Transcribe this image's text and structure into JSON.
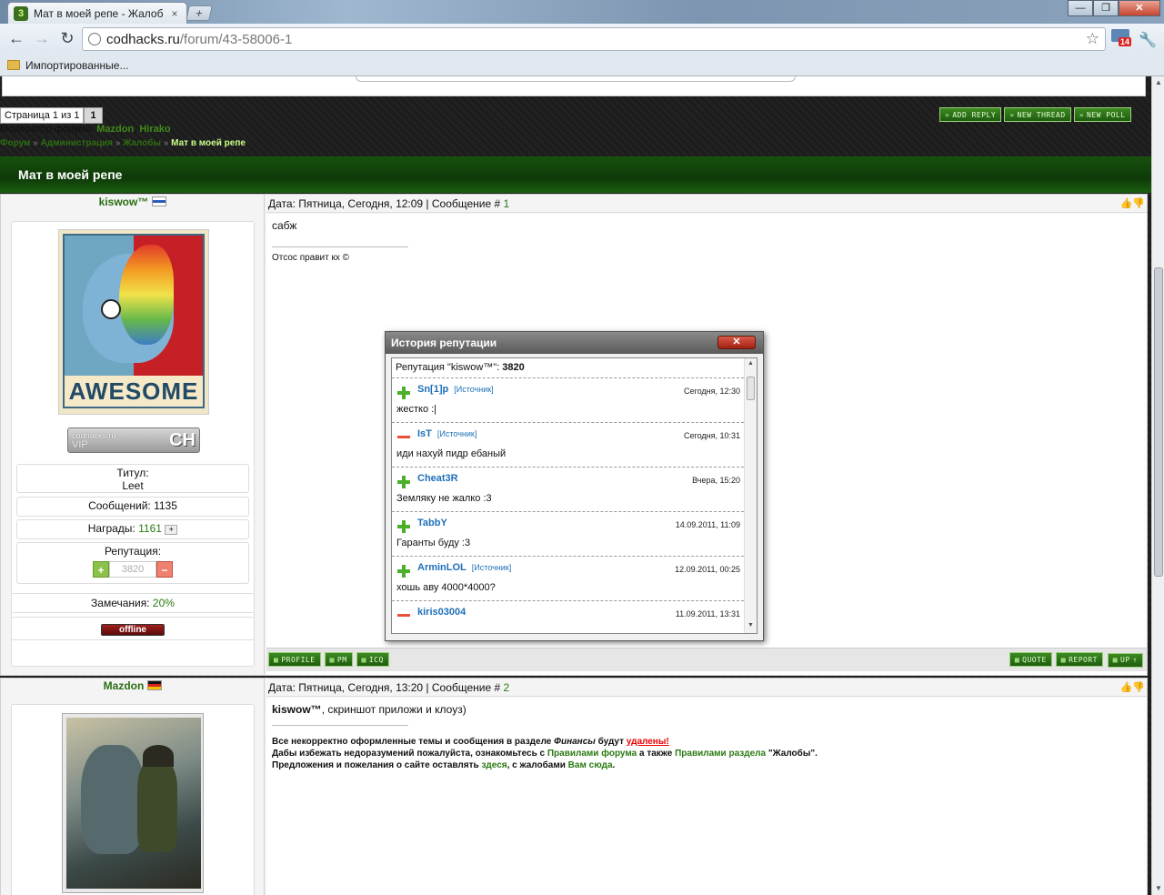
{
  "browser": {
    "tab_title": "Мат в моей репе - Жалобы",
    "tab_close": "×",
    "new_tab": "+",
    "url_host": "codhacks.ru",
    "url_path": "/forum/43-58006-1",
    "mail_badge": "14",
    "bookmark_label": "Импортированные...",
    "window_controls": [
      "—",
      "❐",
      "✕"
    ]
  },
  "forum": {
    "page_label": "Страница 1 из 1",
    "page_num": "1",
    "moderators_prefix": "Модератор форума:",
    "moderators": [
      "Mazdon",
      "Hirako"
    ],
    "crumbs": [
      "Форум",
      "Администрация",
      "Жалобы"
    ],
    "crumb_current": "Мат в моей репе",
    "crumb_sep": "»",
    "buttons_top": [
      "Add Reply",
      "New Thread",
      "New Poll"
    ],
    "thread_title": "Мат в моей репе"
  },
  "post1": {
    "username": "kiswow™",
    "header_prefix": "Дата: Пятница, Сегодня, 12:09 | Сообщение #",
    "post_num": "1",
    "rate_icons": "👍👎",
    "text": "сабж",
    "signature": "Отсос правит кх ©",
    "avatar_text": "AWESOME",
    "vip_small": "codhacks.ru",
    "vip_label": "VIP",
    "vip_logo": "CH",
    "title_label": "Титул:",
    "title_value": "Leet",
    "messages_label": "Сообщений: 1135",
    "awards_label": "Награды:",
    "awards_value": "1161",
    "awards_plus": "+",
    "rep_label": "Репутация:",
    "rep_plus": "+",
    "rep_value": "3820",
    "rep_minus": "−",
    "remarks_label": "Замечания:",
    "remarks_value": "20%",
    "status": "offline",
    "bottom_left": [
      "Profile",
      "PM",
      "ICQ"
    ],
    "bottom_right": [
      "Quote",
      "Report"
    ],
    "up": "UP"
  },
  "post2": {
    "username": "Mazdon",
    "header_prefix": "Дата: Пятница, Сегодня, 13:20 | Сообщение #",
    "post_num": "2",
    "rate_icons": "👍👎",
    "text_user": "kiswow™",
    "text_rest": ", скриншот приложи и клоуз)",
    "notice_l1_a": "Все некорректно оформленные темы и сообщения в разделе ",
    "notice_l1_b": "Финансы",
    "notice_l1_c": " будут ",
    "notice_l1_d": "удалены!",
    "notice_l2_a": "Дабы избежать недоразумений пожалуйста, ознакомьтесь с ",
    "notice_l2_b": "Правилами форума",
    "notice_l2_c": " а также ",
    "notice_l2_d": "Правилами раздела",
    "notice_l2_e": " \"Жалобы\".",
    "notice_l3_a": "Предложения и пожелания о сайте оставлять ",
    "notice_l3_b": "здеся",
    "notice_l3_c": ", с жалобами ",
    "notice_l3_d": "Вам сюда",
    "notice_l3_e": "."
  },
  "popup": {
    "title": "История репутации",
    "close": "✕",
    "header_prefix": "Репутация \"kiswow™\":",
    "header_value": "3820",
    "items": [
      {
        "sign": "plus",
        "user": "Sn[1]p",
        "source": "[Источник]",
        "time": "Сегодня, 12:30",
        "text": "жестко :|"
      },
      {
        "sign": "minus",
        "user": "IsT",
        "source": "[Источник]",
        "time": "Сегодня, 10:31",
        "text": "иди нахуй пидр ебаный"
      },
      {
        "sign": "plus",
        "user": "Cheat3R",
        "source": "",
        "time": "Вчера, 15:20",
        "text": "Земляку не жалко :3"
      },
      {
        "sign": "plus",
        "user": "TabbY",
        "source": "",
        "time": "14.09.2011, 11:09",
        "text": "Гаранты буду :3"
      },
      {
        "sign": "plus",
        "user": "ArminLOL",
        "source": "[Источник]",
        "time": "12.09.2011, 00:25",
        "text": "хошь аву 4000*4000?"
      },
      {
        "sign": "minus",
        "user": "kiris03004",
        "source": "",
        "time": "11.09.2011, 13:31",
        "text": ""
      }
    ]
  }
}
